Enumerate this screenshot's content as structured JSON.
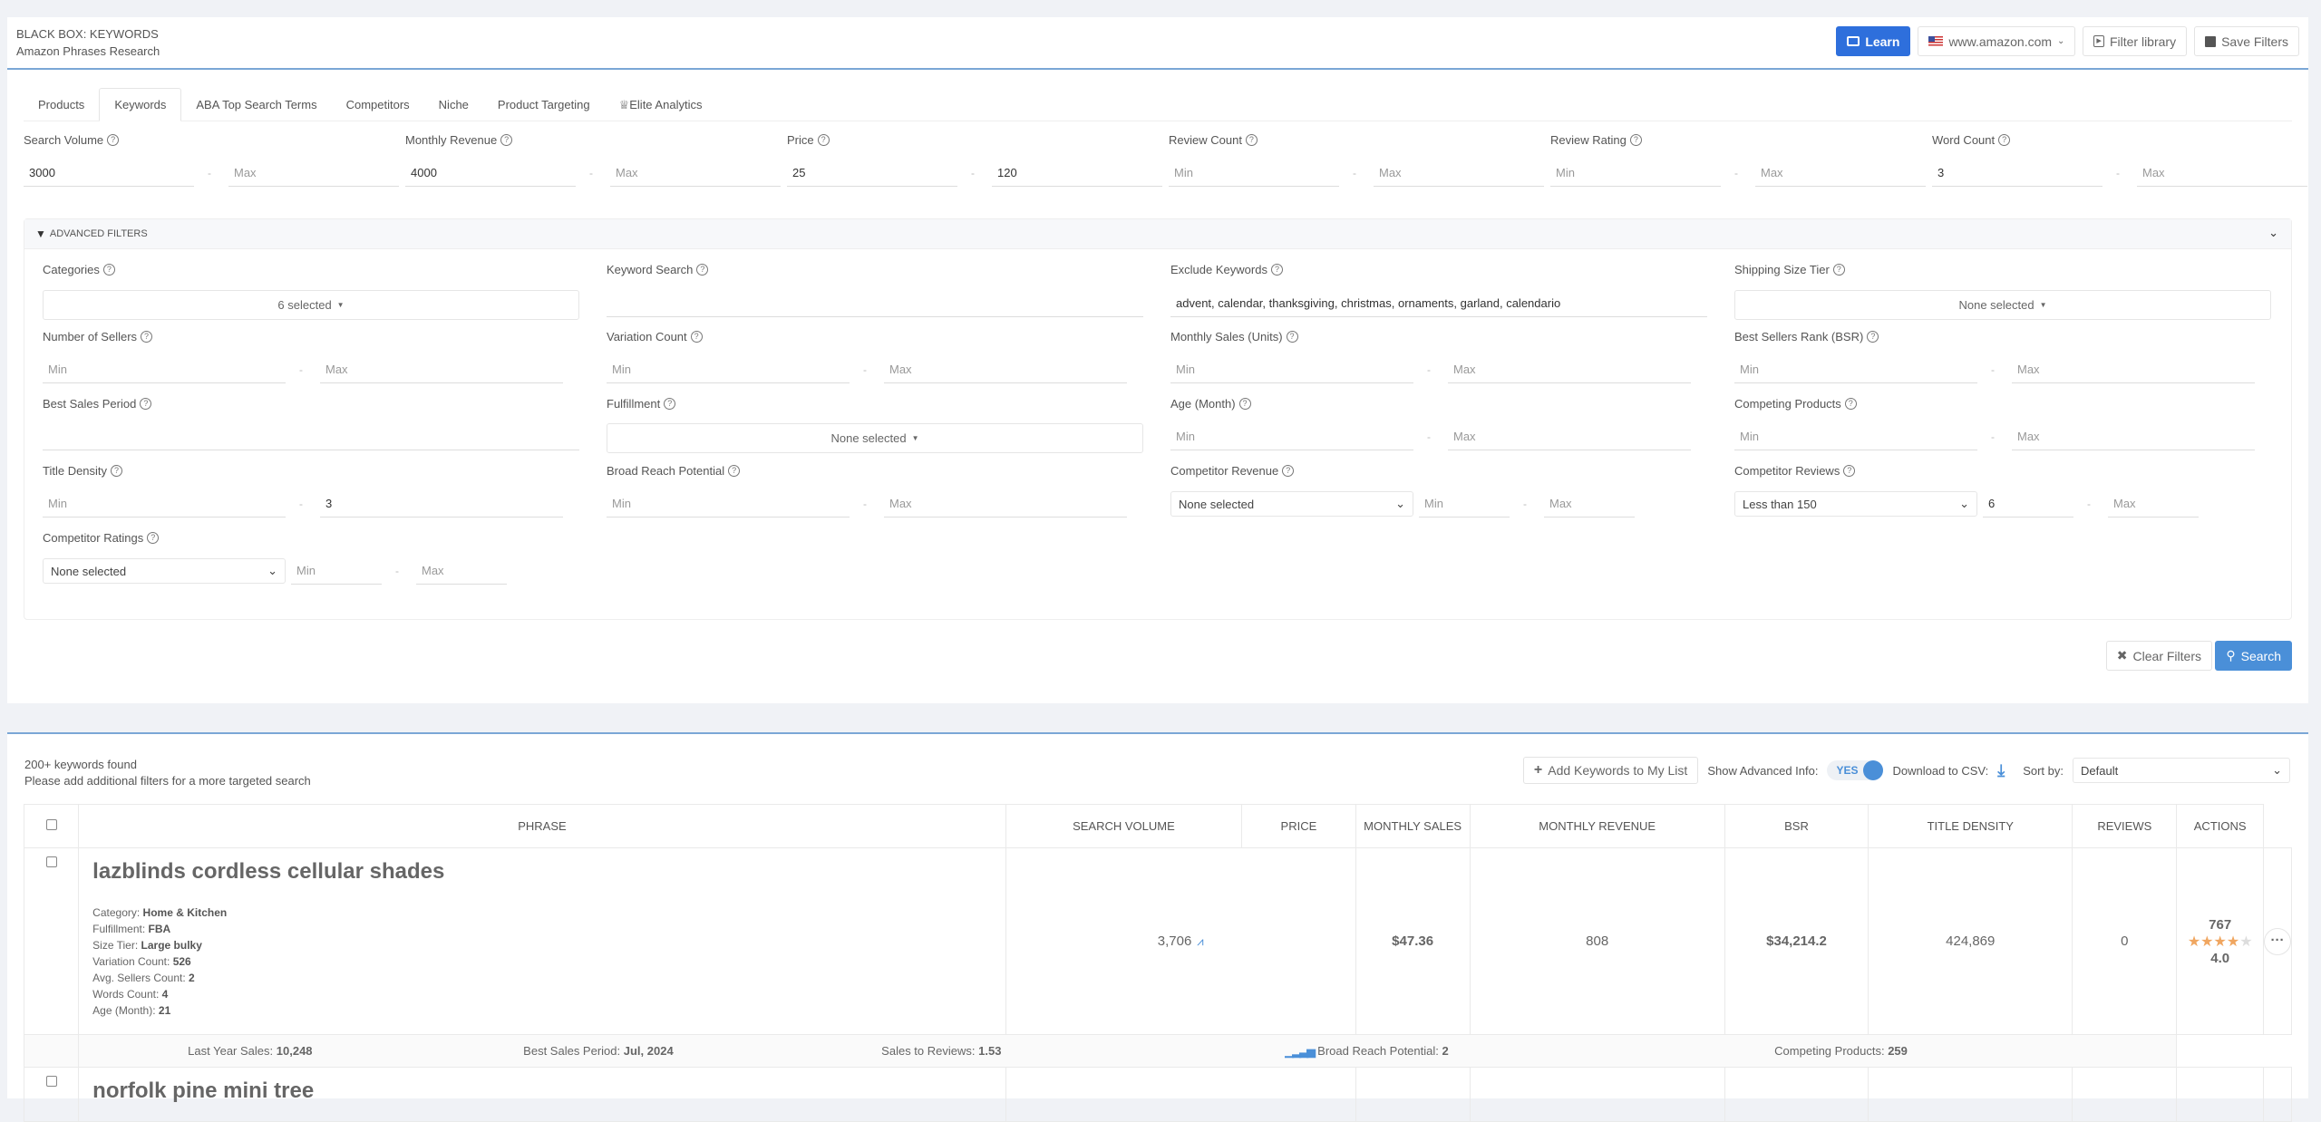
{
  "header": {
    "title": "BLACK BOX: KEYWORDS",
    "subtitle": "Amazon Phrases Research",
    "learn": "Learn",
    "marketplace": "www.amazon.com",
    "filter_library": "Filter library",
    "save_filters": "Save Filters"
  },
  "tabs": [
    "Products",
    "Keywords",
    "ABA Top Search Terms",
    "Competitors",
    "Niche",
    "Product Targeting",
    "Elite Analytics"
  ],
  "active_tab": "Keywords",
  "basic_filters": [
    {
      "label": "Search Volume",
      "min": "3000",
      "max": ""
    },
    {
      "label": "Monthly Revenue",
      "min": "4000",
      "max": ""
    },
    {
      "label": "Price",
      "min": "25",
      "max": "120"
    },
    {
      "label": "Review Count",
      "min": "",
      "max": ""
    },
    {
      "label": "Review Rating",
      "min": "",
      "max": ""
    },
    {
      "label": "Word Count",
      "min": "3",
      "max": ""
    }
  ],
  "placeholders": {
    "min": "Min",
    "max": "Max"
  },
  "advanced": {
    "title": "ADVANCED FILTERS",
    "categories": {
      "label": "Categories",
      "value": "6 selected"
    },
    "keyword_search": {
      "label": "Keyword Search",
      "value": ""
    },
    "exclude_keywords": {
      "label": "Exclude Keywords",
      "value": "advent, calendar, thanksgiving, christmas, ornaments, garland, calendario"
    },
    "shipping_size_tier": {
      "label": "Shipping Size Tier",
      "value": "None selected"
    },
    "number_of_sellers": {
      "label": "Number of Sellers",
      "min": "",
      "max": ""
    },
    "variation_count": {
      "label": "Variation Count",
      "min": "",
      "max": ""
    },
    "monthly_sales": {
      "label": "Monthly Sales (Units)",
      "min": "",
      "max": ""
    },
    "bsr": {
      "label": "Best Sellers Rank (BSR)",
      "min": "",
      "max": ""
    },
    "best_sales_period": {
      "label": "Best Sales Period",
      "value": ""
    },
    "fulfillment": {
      "label": "Fulfillment",
      "value": "None selected"
    },
    "age": {
      "label": "Age (Month)",
      "min": "",
      "max": ""
    },
    "competing_products": {
      "label": "Competing Products",
      "min": "",
      "max": ""
    },
    "title_density": {
      "label": "Title Density",
      "min": "",
      "max": "3"
    },
    "broad_reach": {
      "label": "Broad Reach Potential",
      "min": "",
      "max": ""
    },
    "competitor_revenue": {
      "label": "Competitor Revenue",
      "select": "None selected",
      "min": "",
      "max": ""
    },
    "competitor_reviews": {
      "label": "Competitor Reviews",
      "select": "Less than 150",
      "min": "6",
      "max": ""
    },
    "competitor_ratings": {
      "label": "Competitor Ratings",
      "select": "None selected",
      "min": "",
      "max": ""
    }
  },
  "actions": {
    "clear": "Clear Filters",
    "search": "Search"
  },
  "results": {
    "count": "200+ keywords found",
    "hint": "Please add additional filters for a more targeted search",
    "add_keywords": "Add Keywords to My List",
    "show_advanced": "Show Advanced Info:",
    "toggle": "YES",
    "download": "Download to CSV:",
    "sort_label": "Sort by:",
    "sort_value": "Default",
    "columns": [
      "PHRASE",
      "SEARCH VOLUME",
      "PRICE",
      "MONTHLY SALES",
      "MONTHLY REVENUE",
      "BSR",
      "TITLE DENSITY",
      "REVIEWS",
      "ACTIONS"
    ],
    "rows": [
      {
        "phrase": "lazblinds cordless cellular shades",
        "meta": [
          [
            "Category:",
            "Home & Kitchen"
          ],
          [
            "Fulfillment:",
            "FBA"
          ],
          [
            "Size Tier:",
            "Large bulky"
          ],
          [
            "Variation Count:",
            "526"
          ],
          [
            "Avg. Sellers Count:",
            "2"
          ],
          [
            "Words Count:",
            "4"
          ],
          [
            "Age (Month):",
            "21"
          ]
        ],
        "search_volume": "3,706",
        "price": "$47.36",
        "monthly_sales": "808",
        "monthly_revenue": "$34,214.2",
        "bsr": "424,869",
        "title_density": "0",
        "reviews": "767",
        "rating": "4.0",
        "rating_value": 4,
        "extra": {
          "last_year_sales": [
            "Last Year Sales:",
            "10,248"
          ],
          "best_sales_period": [
            "Best Sales Period:",
            "Jul, 2024"
          ],
          "sales_to_reviews": [
            "Sales to Reviews:",
            "1.53"
          ],
          "broad_reach": [
            "Broad Reach Potential:",
            "2"
          ],
          "competing": [
            "Competing Products:",
            "259"
          ]
        }
      },
      {
        "phrase": "norfolk pine mini tree"
      }
    ]
  }
}
